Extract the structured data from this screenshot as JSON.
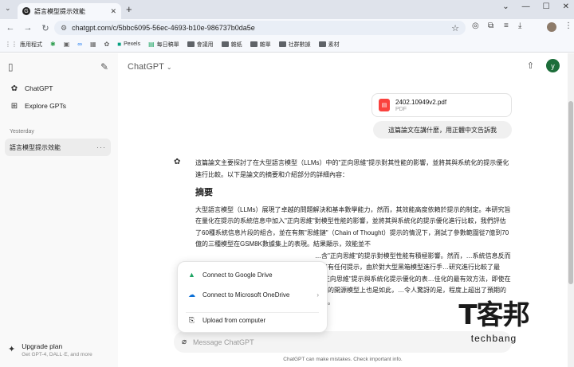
{
  "browser": {
    "tab_title": "語言模型提示效能",
    "tab_favicon": "G",
    "url": "chatgpt.com/c/5bbc6095-56ec-4693-b10e-986737b0da5e",
    "bookmarks": [
      "應用程式",
      "Pexels",
      "每日稿單",
      "會議用",
      "雜紙",
      "雜單",
      "社群數據",
      "素材"
    ]
  },
  "sidebar": {
    "items": [
      {
        "label": "ChatGPT",
        "icon": "openai-logo-icon"
      },
      {
        "label": "Explore GPTs",
        "icon": "grid-icon"
      }
    ],
    "section_label": "Yesterday",
    "conversation": "語言模型提示效能",
    "upgrade_title": "Upgrade plan",
    "upgrade_sub": "Get GPT-4, DALL·E, and more"
  },
  "main": {
    "model_name": "ChatGPT",
    "avatar_letter": "y",
    "file": {
      "name": "2402.10949v2.pdf",
      "type": "PDF"
    },
    "user_message": "這篇論文在講什麼，用正體中文告訴我",
    "reply": {
      "intro": "這篇論文主要探討了在大型語言模型（LLMs）中的\"正向思維\"提示對其性能的影響，並將其與系統化的提示優化進行比較。以下是論文的摘要和介紹部分的詳細內容：",
      "heading": "摘要",
      "para1": "大型語言模型（LLMs）展現了卓越的問題解決和基本數學能力，然而，其效能高度依賴於提示的制定。本研究旨在量化在提示的系統信息中加入\"正向思維\"對模型性能的影響，並將其與系統化的提示優化進行比較，我們評估了60種系統信息片段的組合，並在有無\"思維鏈\"（Chain of Thought）提示的情況下，測試了參數範圍從7億到70億的三種模型在GSM8K數據集上的表現。結果顯示，效能並不",
      "para2": "…含\"正向思維\"的提示對模型性能有積極影響。然而，…系統信息反而是沒有任何提示，由於對大型黑箱模型進行手…研究進行比較了最佳\"正向思維\"提示與系統化提示優化的表…佳化的最有效方法，即使在較小的開源模型上也是如此，…令人驚訝的是，程度上超出了預期的奇特。"
    },
    "popup": {
      "google_drive": "Connect to Google Drive",
      "onedrive": "Connect to Microsoft OneDrive",
      "upload": "Upload from computer"
    },
    "composer_placeholder": "Message ChatGPT",
    "disclaimer": "ChatGPT can make mistakes. Check important info."
  },
  "watermark": {
    "line1": "T客邦",
    "line2": "techbang"
  }
}
